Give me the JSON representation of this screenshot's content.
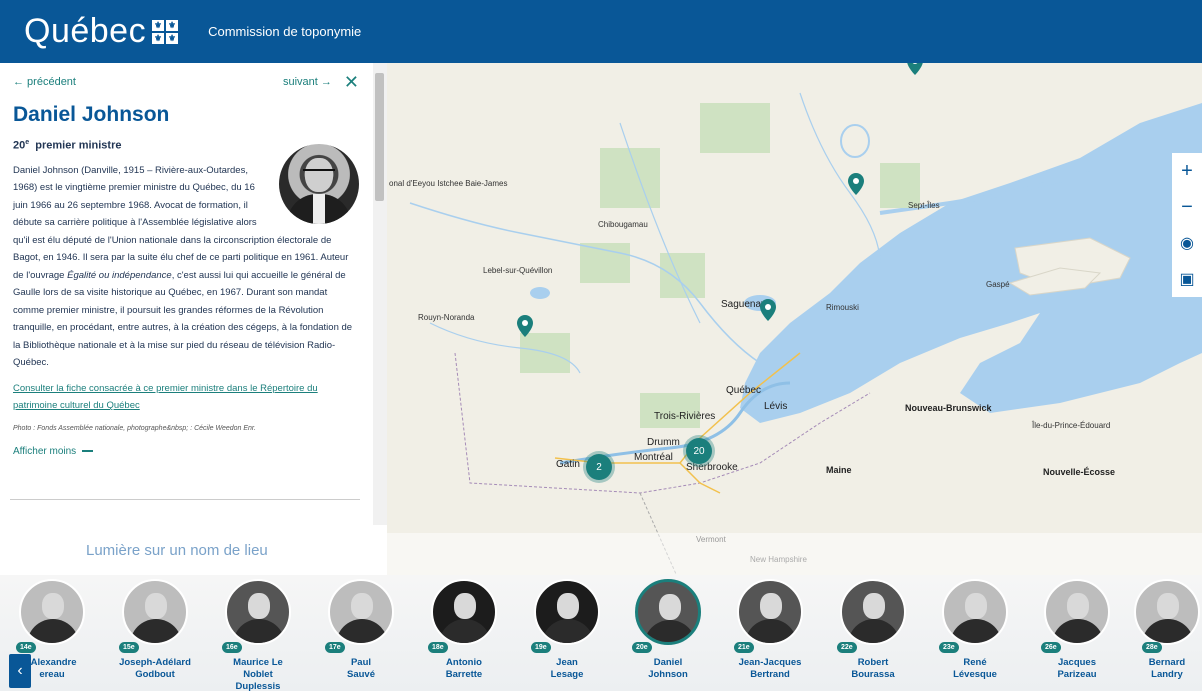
{
  "header": {
    "logo_text": "Québec",
    "site_title": "Commission de toponymie"
  },
  "panel": {
    "prev_label": "← précédent",
    "next_label": "suivant →",
    "close_label": "✕",
    "name": "Daniel Johnson",
    "rank_num": "20",
    "rank_sup": "e",
    "rank_text": "premier ministre",
    "bio_1": "Daniel Johnson (Danville, 1915 – Rivière-aux-Outardes, 1968) est le vingtième premier ministre du Québec, du 16 juin 1966 au 26 septembre 1968. Avocat de formation, il débute sa carrière politique à l'Assemblée législative alors qu'il est élu député de l'Union nationale dans la circonscription électorale de Bagot, en 1946. Il sera par la suite élu chef de ce parti politique en 1961. Auteur de l'ouvrage ",
    "bio_title": "Égalité ou indépendance",
    "bio_2": ", c'est aussi lui qui accueille le général de Gaulle lors de sa visite historique au Québec, en 1967. Durant son mandat comme premier ministre, il poursuit les grandes réformes de la Révolution tranquille, en procédant, entre autres, à la création des cégeps, à la fondation de la Bibliothèque nationale et à la mise sur pied du réseau de télévision Radio-Québec.",
    "link_text": "Consulter la fiche consacrée à ce premier ministre dans le Répertoire du patrimoine culturel du Québec",
    "credit": "Photo : Fonds Assemblée nationale, photographe&nbsp; : Cécile Weedon Enr.",
    "toggle_label": "Afficher moins",
    "spotlight_title": "Lumière sur un nom de lieu"
  },
  "map": {
    "labels": {
      "eeyou": "onal d'Eeyou Istchee Baie-James",
      "chibougamau": "Chibougamau",
      "lebel": "Lebel-sur-Quévillon",
      "rouyn": "Rouyn-Noranda",
      "saguenay": "Saguenay",
      "rimouski": "Rimouski",
      "septiles": "Sept-Îles",
      "gaspe": "Gaspé",
      "quebec": "Québec",
      "levis": "Lévis",
      "troisrivieres": "Trois-Rivières",
      "drummond": "Drumm",
      "montreal": "Montréal",
      "sherbrooke": "Sherbrooke",
      "gatineau": "Gatin",
      "nb": "Nouveau-Brunswick",
      "ipe": "Île-du-Prince-Édouard",
      "maine": "Maine",
      "ne": "Nouvelle-Écosse",
      "vermont": "Vermont",
      "nh": "New Hampshire"
    },
    "clusters": [
      "2",
      "20"
    ],
    "controls": {
      "zoom_in": "+",
      "zoom_out": "−",
      "locate": "◉",
      "layers": "▣"
    }
  },
  "carousel": {
    "prev_label": "‹",
    "items": [
      {
        "rank": "14e",
        "name": "-Alexandre\nereau"
      },
      {
        "rank": "15e",
        "name": "Joseph-Adélard\nGodbout"
      },
      {
        "rank": "16e",
        "name": "Maurice Le\nNoblet\nDuplessis"
      },
      {
        "rank": "17e",
        "name": "Paul\nSauvé"
      },
      {
        "rank": "18e",
        "name": "Antonio\nBarrette"
      },
      {
        "rank": "19e",
        "name": "Jean\nLesage"
      },
      {
        "rank": "20e",
        "name": "Daniel\nJohnson"
      },
      {
        "rank": "21e",
        "name": "Jean-Jacques\nBertrand"
      },
      {
        "rank": "22e",
        "name": "Robert\nBourassa"
      },
      {
        "rank": "23e",
        "name": "René\nLévesque"
      },
      {
        "rank": "26e",
        "name": "Jacques\nParizeau"
      },
      {
        "rank": "28e",
        "name": "Bernard\nLandry"
      }
    ]
  },
  "colors": {
    "brand": "#095797",
    "accent": "#1b7f7c",
    "water": "#a9cfee",
    "land": "#f1efe6"
  }
}
